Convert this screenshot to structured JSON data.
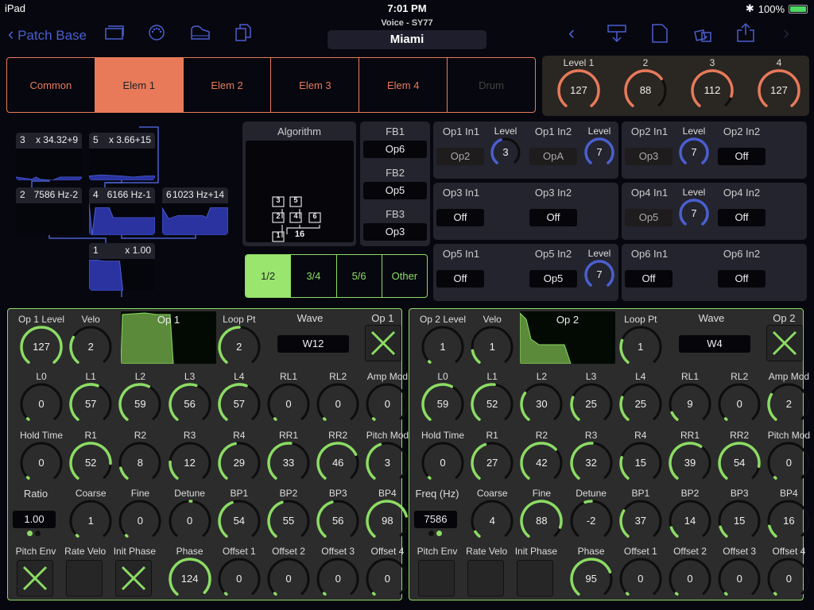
{
  "status_bar": {
    "device": "iPad",
    "time": "7:01 PM",
    "battery": "100%"
  },
  "nav": {
    "back_label": "Patch Base",
    "subtitle": "Voice - SY77",
    "patch_name": "Miami"
  },
  "element_tabs": [
    {
      "label": "Common",
      "state": "normal"
    },
    {
      "label": "Elem 1",
      "state": "active"
    },
    {
      "label": "Elem 2",
      "state": "normal"
    },
    {
      "label": "Elem 3",
      "state": "normal"
    },
    {
      "label": "Elem 4",
      "state": "normal"
    },
    {
      "label": "Drum",
      "state": "disabled"
    }
  ],
  "levels": [
    {
      "label": "Level 1",
      "value": 127,
      "max": 127
    },
    {
      "label": "2",
      "value": 88,
      "max": 127
    },
    {
      "label": "3",
      "value": 112,
      "max": 127
    },
    {
      "label": "4",
      "value": 127,
      "max": 127
    }
  ],
  "operators_overview": [
    {
      "num": "3",
      "info": "x 34.32+9"
    },
    {
      "num": "5",
      "info": "x 3.66+15"
    },
    {
      "num": "2",
      "info": "7586 Hz-2"
    },
    {
      "num": "4",
      "info": "6166 Hz-1"
    },
    {
      "num": "6",
      "info": "1023 Hz+14"
    },
    {
      "num": "1",
      "info": "x 1.00"
    }
  ],
  "algorithm": {
    "title": "Algorithm",
    "number": "16",
    "ops": [
      "3",
      "5",
      "2",
      "4",
      "6",
      "1"
    ]
  },
  "feedback": [
    {
      "label": "FB1",
      "value": "Op6"
    },
    {
      "label": "FB2",
      "value": "Op5"
    },
    {
      "label": "FB3",
      "value": "Op3"
    }
  ],
  "op_tabs": [
    {
      "label": "1/2",
      "active": true
    },
    {
      "label": "3/4",
      "active": false
    },
    {
      "label": "5/6",
      "active": false
    },
    {
      "label": "Other",
      "active": false
    }
  ],
  "inputs": {
    "op1": {
      "in1_label": "Op1 In1",
      "in1": "Op2",
      "lvl1_label": "Level",
      "lvl1": 3,
      "in2_label": "Op1 In2",
      "in2": "OpA",
      "lvl2_label": "Level",
      "lvl2": 7
    },
    "op2": {
      "in1_label": "Op2 In1",
      "in1": "Op3",
      "lvl1_label": "Level",
      "lvl1": 7,
      "in2_label": "Op2 In2",
      "in2": "Off"
    },
    "op3": {
      "in1_label": "Op3 In1",
      "in1": "Off",
      "in2_label": "Op3 In2",
      "in2": "Off"
    },
    "op4": {
      "in1_label": "Op4 In1",
      "in1": "Op5",
      "lvl1_label": "Level",
      "lvl1": 7,
      "in2_label": "Op4 In2",
      "in2": "Off"
    },
    "op5": {
      "in1_label": "Op5 In1",
      "in1": "Off",
      "in2_label": "Op5 In2",
      "in2": "Op5",
      "lvl2_label": "Level",
      "lvl2": 7
    },
    "op6": {
      "in1_label": "Op6 In1",
      "in1": "Off",
      "in2_label": "Op6 In2",
      "in2": "Off"
    }
  },
  "op_panels": [
    {
      "title": "Op 1",
      "level_label": "Op 1 Level",
      "level": 127,
      "velo": 2,
      "loop_pt": 2,
      "wave_label": "Wave",
      "wave": "W12",
      "loop_label": "Loop Pt",
      "enable_label": "Op 1",
      "enabled": true,
      "row2": [
        [
          "L0",
          0
        ],
        [
          "L1",
          57
        ],
        [
          "L2",
          59
        ],
        [
          "L3",
          56
        ],
        [
          "L4",
          57
        ],
        [
          "RL1",
          0
        ],
        [
          "RL2",
          0
        ],
        [
          "Amp Mod",
          0
        ]
      ],
      "row3": [
        [
          "Hold Time",
          0
        ],
        [
          "R1",
          52
        ],
        [
          "R2",
          8
        ],
        [
          "R3",
          12
        ],
        [
          "R4",
          29
        ],
        [
          "RR1",
          33
        ],
        [
          "RR2",
          46
        ],
        [
          "Pitch Mod",
          3
        ]
      ],
      "freq_label": "Ratio",
      "freq": "1.00",
      "freq_mode": 0,
      "row4": [
        [
          "Coarse",
          1
        ],
        [
          "Fine",
          0
        ],
        [
          "Detune",
          0
        ],
        [
          "BP1",
          54
        ],
        [
          "BP2",
          55
        ],
        [
          "BP3",
          56
        ],
        [
          "BP4",
          98
        ]
      ],
      "checks": [
        [
          "Pitch Env",
          true
        ],
        [
          "Rate Velo",
          false
        ],
        [
          "Init Phase",
          true
        ]
      ],
      "row5": [
        [
          "Phase",
          124
        ],
        [
          "Offset 1",
          0
        ],
        [
          "Offset 2",
          0
        ],
        [
          "Offset 3",
          0
        ],
        [
          "Offset 4",
          0
        ]
      ]
    },
    {
      "title": "Op 2",
      "level_label": "Op 2 Level",
      "level": 1,
      "velo": 1,
      "loop_pt": 1,
      "wave_label": "Wave",
      "wave": "W4",
      "loop_label": "Loop Pt",
      "enable_label": "Op 2",
      "enabled": true,
      "row2": [
        [
          "L0",
          59
        ],
        [
          "L1",
          52
        ],
        [
          "L2",
          30
        ],
        [
          "L3",
          25
        ],
        [
          "L4",
          25
        ],
        [
          "RL1",
          9
        ],
        [
          "RL2",
          0
        ],
        [
          "Amp Mod",
          2
        ]
      ],
      "row3": [
        [
          "Hold Time",
          0
        ],
        [
          "R1",
          27
        ],
        [
          "R2",
          42
        ],
        [
          "R3",
          32
        ],
        [
          "R4",
          15
        ],
        [
          "RR1",
          39
        ],
        [
          "RR2",
          54
        ],
        [
          "Pitch Mod",
          0
        ]
      ],
      "freq_label": "Freq (Hz)",
      "freq": "7586",
      "freq_mode": 1,
      "row4": [
        [
          "Coarse",
          4
        ],
        [
          "Fine",
          88
        ],
        [
          "Detune",
          -2
        ],
        [
          "BP1",
          37
        ],
        [
          "BP2",
          14
        ],
        [
          "BP3",
          15
        ],
        [
          "BP4",
          16
        ]
      ],
      "checks": [
        [
          "Pitch Env",
          false
        ],
        [
          "Rate Velo",
          false
        ],
        [
          "Init Phase",
          false
        ]
      ],
      "row5": [
        [
          "Phase",
          95
        ],
        [
          "Offset 1",
          0
        ],
        [
          "Offset 2",
          0
        ],
        [
          "Offset 3",
          0
        ],
        [
          "Offset 4",
          0
        ]
      ]
    }
  ],
  "colors": {
    "orange": "#e87a5a",
    "green": "#8cdc64",
    "blue": "#4a5fd0"
  }
}
